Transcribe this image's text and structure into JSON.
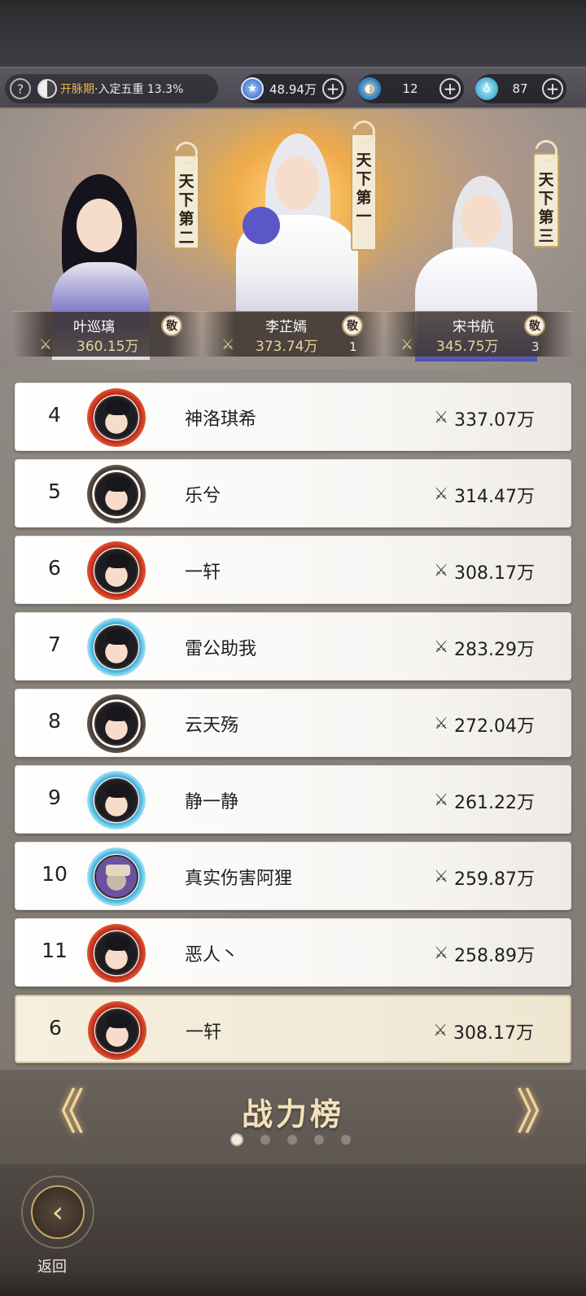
{
  "resources": {
    "help": "?",
    "realm_stage": "开脉期",
    "realm_detail": "·入定五重 13.3%",
    "currency1": "48.94万",
    "currency2": "12",
    "currency3": "87",
    "plus": "+"
  },
  "top3": [
    {
      "rank": 2,
      "banner": "天下第二",
      "name": "叶巡璃",
      "power": "360.15万",
      "respect": "敬",
      "respect_count": ""
    },
    {
      "rank": 1,
      "banner": "天下第一",
      "name": "李芷嫣",
      "power": "373.74万",
      "respect": "敬",
      "respect_count": "1"
    },
    {
      "rank": 3,
      "banner": "天下第三",
      "name": "宋书航",
      "power": "345.75万",
      "respect": "敬",
      "respect_count": "3"
    }
  ],
  "ranking": [
    {
      "rank": "4",
      "name": "神洛琪希",
      "power": "337.07万",
      "frame": "fire"
    },
    {
      "rank": "5",
      "name": "乐兮",
      "power": "314.47万",
      "frame": "plain"
    },
    {
      "rank": "6",
      "name": "一轩",
      "power": "308.17万",
      "frame": "fire"
    },
    {
      "rank": "7",
      "name": "雷公助我",
      "power": "283.29万",
      "frame": "water"
    },
    {
      "rank": "8",
      "name": "云天殇",
      "power": "272.04万",
      "frame": "plain"
    },
    {
      "rank": "9",
      "name": "静一静",
      "power": "261.22万",
      "frame": "water"
    },
    {
      "rank": "10",
      "name": "真实伤害阿狸",
      "power": "259.87万",
      "frame": "tiger"
    },
    {
      "rank": "11",
      "name": "恶人丶",
      "power": "258.89万",
      "frame": "fire"
    }
  ],
  "my_rank": {
    "rank": "6",
    "name": "一轩",
    "power": "308.17万",
    "frame": "fire"
  },
  "board": {
    "title": "战力榜",
    "page_count": 5,
    "active_page": 1,
    "prev": "《",
    "next": "》"
  },
  "back": {
    "label": "返回"
  },
  "icons": {
    "swords": "swords-icon",
    "respect": "respect-icon",
    "help": "help-icon"
  }
}
